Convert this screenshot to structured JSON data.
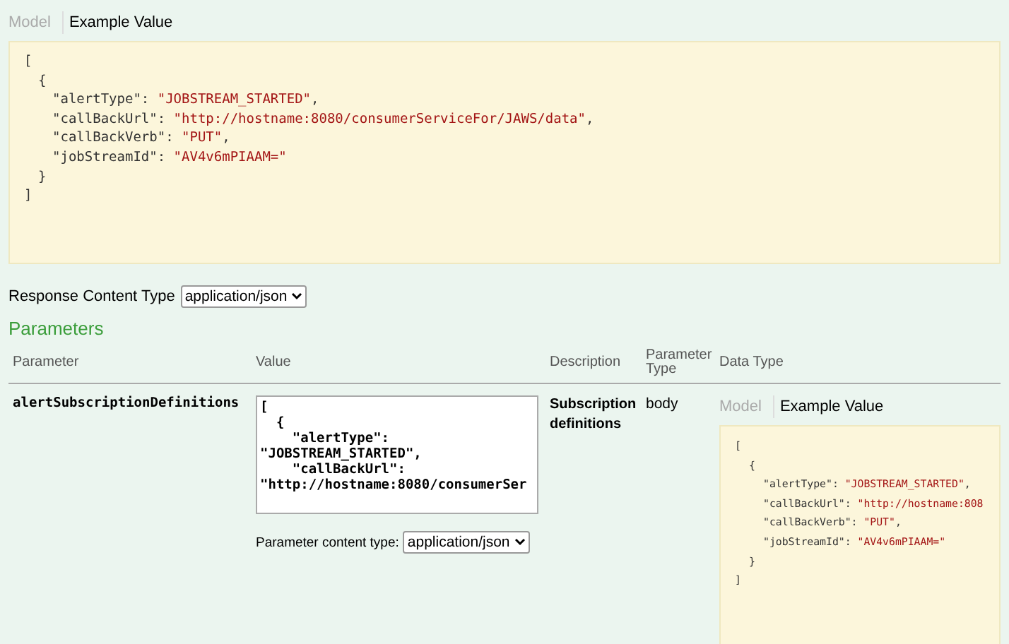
{
  "model_tabs": [
    {
      "label": "Model",
      "selected": false
    },
    {
      "label": "Example Value",
      "selected": true
    }
  ],
  "example": {
    "open": "[",
    "items": [
      {
        "open": "{",
        "fields": [
          {
            "key": "\"alertType\": ",
            "value": "\"JOBSTREAM_STARTED\"",
            "trail": ","
          },
          {
            "key": "\"callBackUrl\": ",
            "value": "\"http://hostname:8080/consumerServiceFor/JAWS/data\"",
            "trail": ","
          },
          {
            "key": "\"callBackVerb\": ",
            "value": "\"PUT\"",
            "trail": ","
          },
          {
            "key": "\"jobStreamId\": ",
            "value": "\"AV4v6mPIAAM=\""
          }
        ],
        "close": "}"
      }
    ],
    "close": "]"
  },
  "response_content_type": {
    "label": "Response Content Type",
    "value": "application/json"
  },
  "parameters": {
    "title": "Parameters",
    "columns": [
      "Parameter",
      "Value",
      "Description",
      "Parameter Type",
      "Data Type"
    ],
    "rows": [
      {
        "name": "alertSubscriptionDefinitions",
        "value": "[\n  {\n    \"alertType\": \"JOBSTREAM_STARTED\",\n    \"callBackUrl\": \"http://hostname:8080/consumerSer",
        "content_type_label": "Parameter content type:",
        "content_type": "application/json",
        "description": "Subscription definitions",
        "param_type": "body",
        "data_type": {
          "tabs": [
            {
              "label": "Model",
              "selected": false
            },
            {
              "label": "Example Value",
              "selected": true
            }
          ],
          "example": {
            "open": "[",
            "items": [
              {
                "open": "{",
                "fields": [
                  {
                    "key": "\"alertType\": ",
                    "value": "\"JOBSTREAM_STARTED\"",
                    "trail": ","
                  },
                  {
                    "key": "\"callBackUrl\": ",
                    "value": "\"http://hostname:808"
                  },
                  {
                    "key": "\"callBackVerb\": ",
                    "value": "\"PUT\"",
                    "trail": ","
                  },
                  {
                    "key": "\"jobStreamId\": ",
                    "value": "\"AV4v6mPIAAM=\""
                  }
                ],
                "close": "}"
              }
            ],
            "close": "]"
          }
        }
      }
    ]
  }
}
